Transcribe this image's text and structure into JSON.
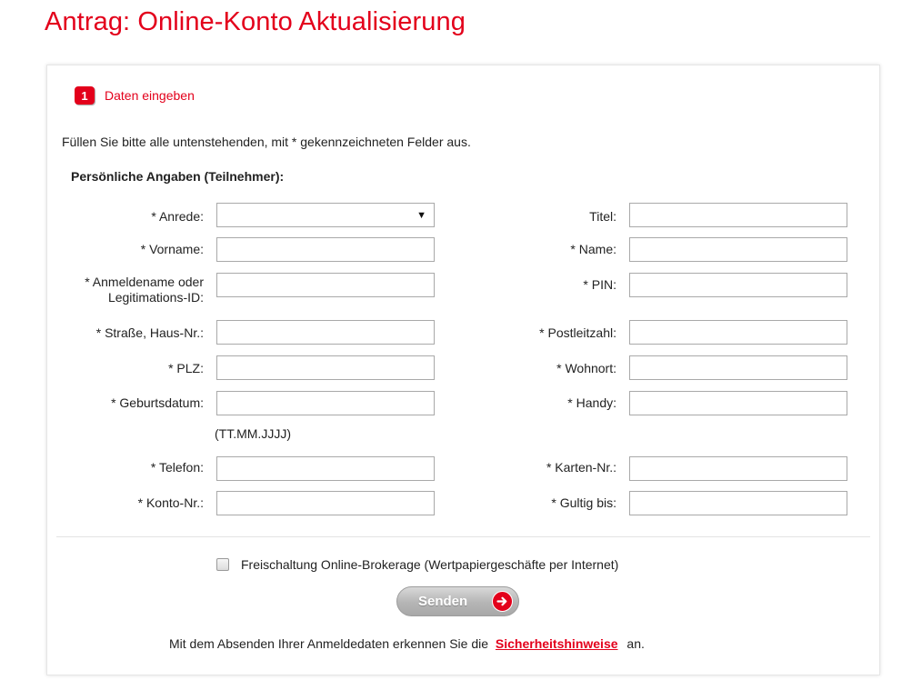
{
  "page": {
    "title": "Antrag: Online-Konto Aktualisierung"
  },
  "step": {
    "number": "1",
    "label": "Daten eingeben"
  },
  "form": {
    "instruction": "Füllen Sie bitte alle untenstehenden, mit * gekennzeichneten Felder aus.",
    "section_title": "Persönliche Angaben (Teilnehmer):",
    "left_fields": [
      {
        "label": "* Anrede:",
        "type": "select",
        "value": ""
      },
      {
        "label": "* Vorname:",
        "value": ""
      },
      {
        "label": "* Anmeldename oder Legitimations-ID:",
        "value": ""
      },
      {
        "label": "* Straße, Haus-Nr.:",
        "value": ""
      },
      {
        "label": "* PLZ:",
        "value": ""
      },
      {
        "label": "* Geburtsdatum:",
        "value": ""
      },
      {
        "label": "* Telefon:",
        "value": ""
      },
      {
        "label": "* Konto-Nr.:",
        "value": ""
      }
    ],
    "right_fields": [
      {
        "label": "Titel:",
        "value": ""
      },
      {
        "label": "* Name:",
        "value": ""
      },
      {
        "label": "* PIN:",
        "value": ""
      },
      {
        "label": "* Postleitzahl:",
        "value": ""
      },
      {
        "label": "* Wohnort:",
        "value": ""
      },
      {
        "label": "* Handy:",
        "value": ""
      },
      {
        "label": "* Karten-Nr.:",
        "value": ""
      },
      {
        "label": "* Gultig bis:",
        "value": ""
      }
    ],
    "date_hint": "(TT.MM.JJJJ)",
    "checkbox_label": "Freischaltung Online-Brokerage (Wertpapiergeschäfte per Internet)",
    "checkbox_checked": false,
    "submit_label": "Senden",
    "footer_before": "Mit dem Absenden Ihrer Anmeldedaten erkennen Sie die",
    "footer_link": "Sicherheitshinweise",
    "footer_after": "an."
  },
  "icons": {
    "step": "step-number-badge",
    "submit": "arrow-right-circle-icon",
    "select": "dropdown-arrow-icon"
  },
  "colors": {
    "accent": "#e3001b",
    "button": "#b5b5b5"
  }
}
